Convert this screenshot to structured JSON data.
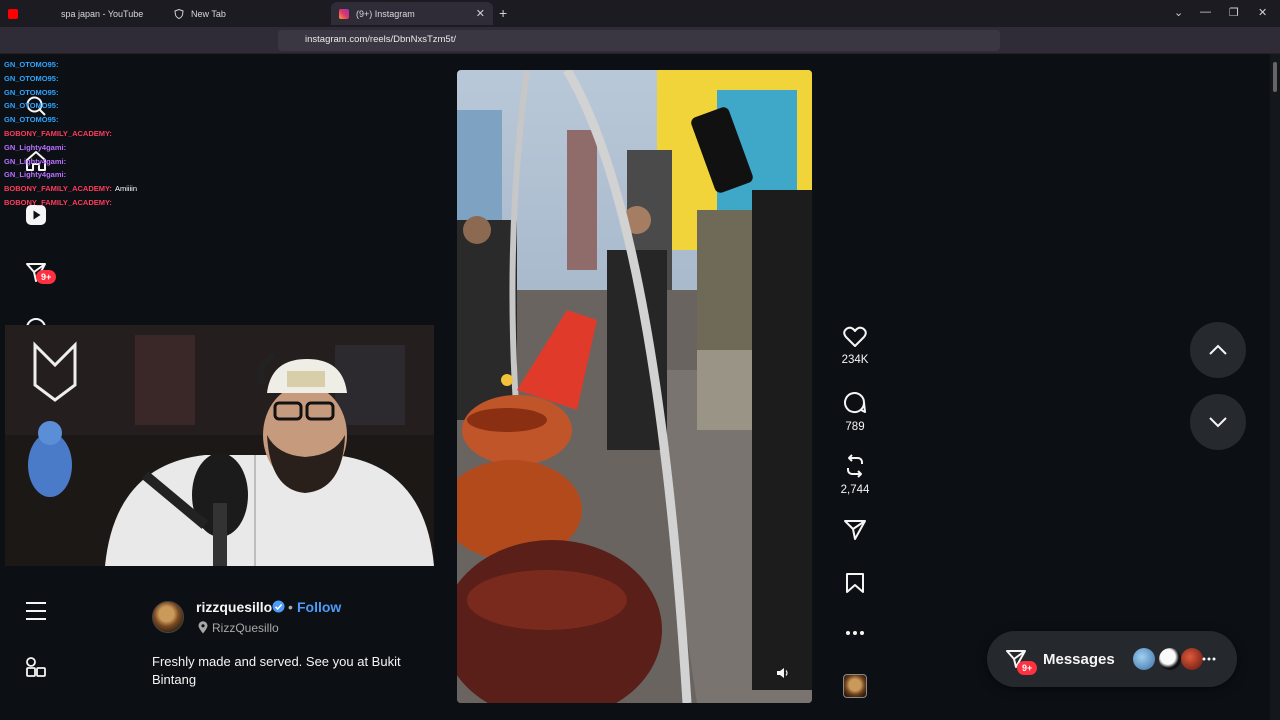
{
  "browser": {
    "tabs": [
      {
        "label": "spa japan - YouTube"
      },
      {
        "label": "New Tab"
      },
      {
        "label": "(9+) Instagram"
      }
    ],
    "url": "instagram.com/reels/DbnNxsTzm5t/"
  },
  "chat": [
    {
      "user": "GN_OTOMO95:",
      "color": "#2fa4ff",
      "msg": ""
    },
    {
      "user": "GN_OTOMO95:",
      "color": "#2fa4ff",
      "msg": ""
    },
    {
      "user": "GN_OTOMO95:",
      "color": "#2fa4ff",
      "msg": ""
    },
    {
      "user": "GN_OTOMO95:",
      "color": "#2fa4ff",
      "msg": ""
    },
    {
      "user": "GN_OTOMO95:",
      "color": "#2fa4ff",
      "msg": ""
    },
    {
      "user": "BOBONY_FAMILY_ACADEMY:",
      "color": "#ff3b5c",
      "msg": ""
    },
    {
      "user": "GN_Lighty4gami:",
      "color": "#b970ff",
      "msg": ""
    },
    {
      "user": "GN_Lighty4gami:",
      "color": "#b970ff",
      "msg": ""
    },
    {
      "user": "GN_Lighty4gami:",
      "color": "#b970ff",
      "msg": ""
    },
    {
      "user": "BOBONY_FAMILY_ACADEMY:",
      "color": "#ff3b5c",
      "msg": "Amiiiin"
    },
    {
      "user": "BOBONY_FAMILY_ACADEMY:",
      "color": "#ff3b5c",
      "msg": ""
    }
  ],
  "sidebar": {
    "notifications_badge": "9+"
  },
  "reel": {
    "likes": "234K",
    "comments": "789",
    "reposts": "2,744"
  },
  "post": {
    "username": "rizzquesillo",
    "separator": "•",
    "follow_label": "Follow",
    "location": "RizzQuesillo",
    "caption": "Freshly made and served. See you at Bukit Bintang"
  },
  "messages": {
    "label": "Messages",
    "badge": "9+"
  },
  "colors": {
    "accent": "#4c9bf8",
    "badge": "#ff3040",
    "background": "#0c1014"
  }
}
